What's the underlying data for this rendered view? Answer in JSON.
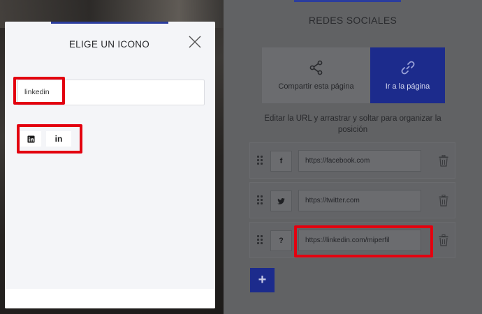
{
  "modal": {
    "title": "ELIGE UN ICONO",
    "search_value": "linkedin",
    "results": [
      {
        "icon": "linkedin-square-icon"
      },
      {
        "icon": "linkedin-in-icon",
        "glyph": "in"
      }
    ]
  },
  "panel": {
    "title": "REDES SOCIALES",
    "tabs": [
      {
        "label": "Compartir esta página",
        "icon": "share-icon",
        "active": false
      },
      {
        "label": "Ir a la página",
        "icon": "link-icon",
        "active": true
      }
    ],
    "hint": "Editar la URL y arrastrar y soltar para organizar la posición",
    "rows": [
      {
        "icon": "facebook-icon",
        "glyph": "f",
        "url": "https://facebook.com"
      },
      {
        "icon": "twitter-icon",
        "glyph": "",
        "url": "https://twitter.com"
      },
      {
        "icon": "unknown-icon",
        "glyph": "?",
        "url": "https://linkedin.com/miperfil"
      }
    ],
    "add_label": "+"
  },
  "colors": {
    "accent": "#1c2b8c",
    "highlight": "#e3000f"
  }
}
